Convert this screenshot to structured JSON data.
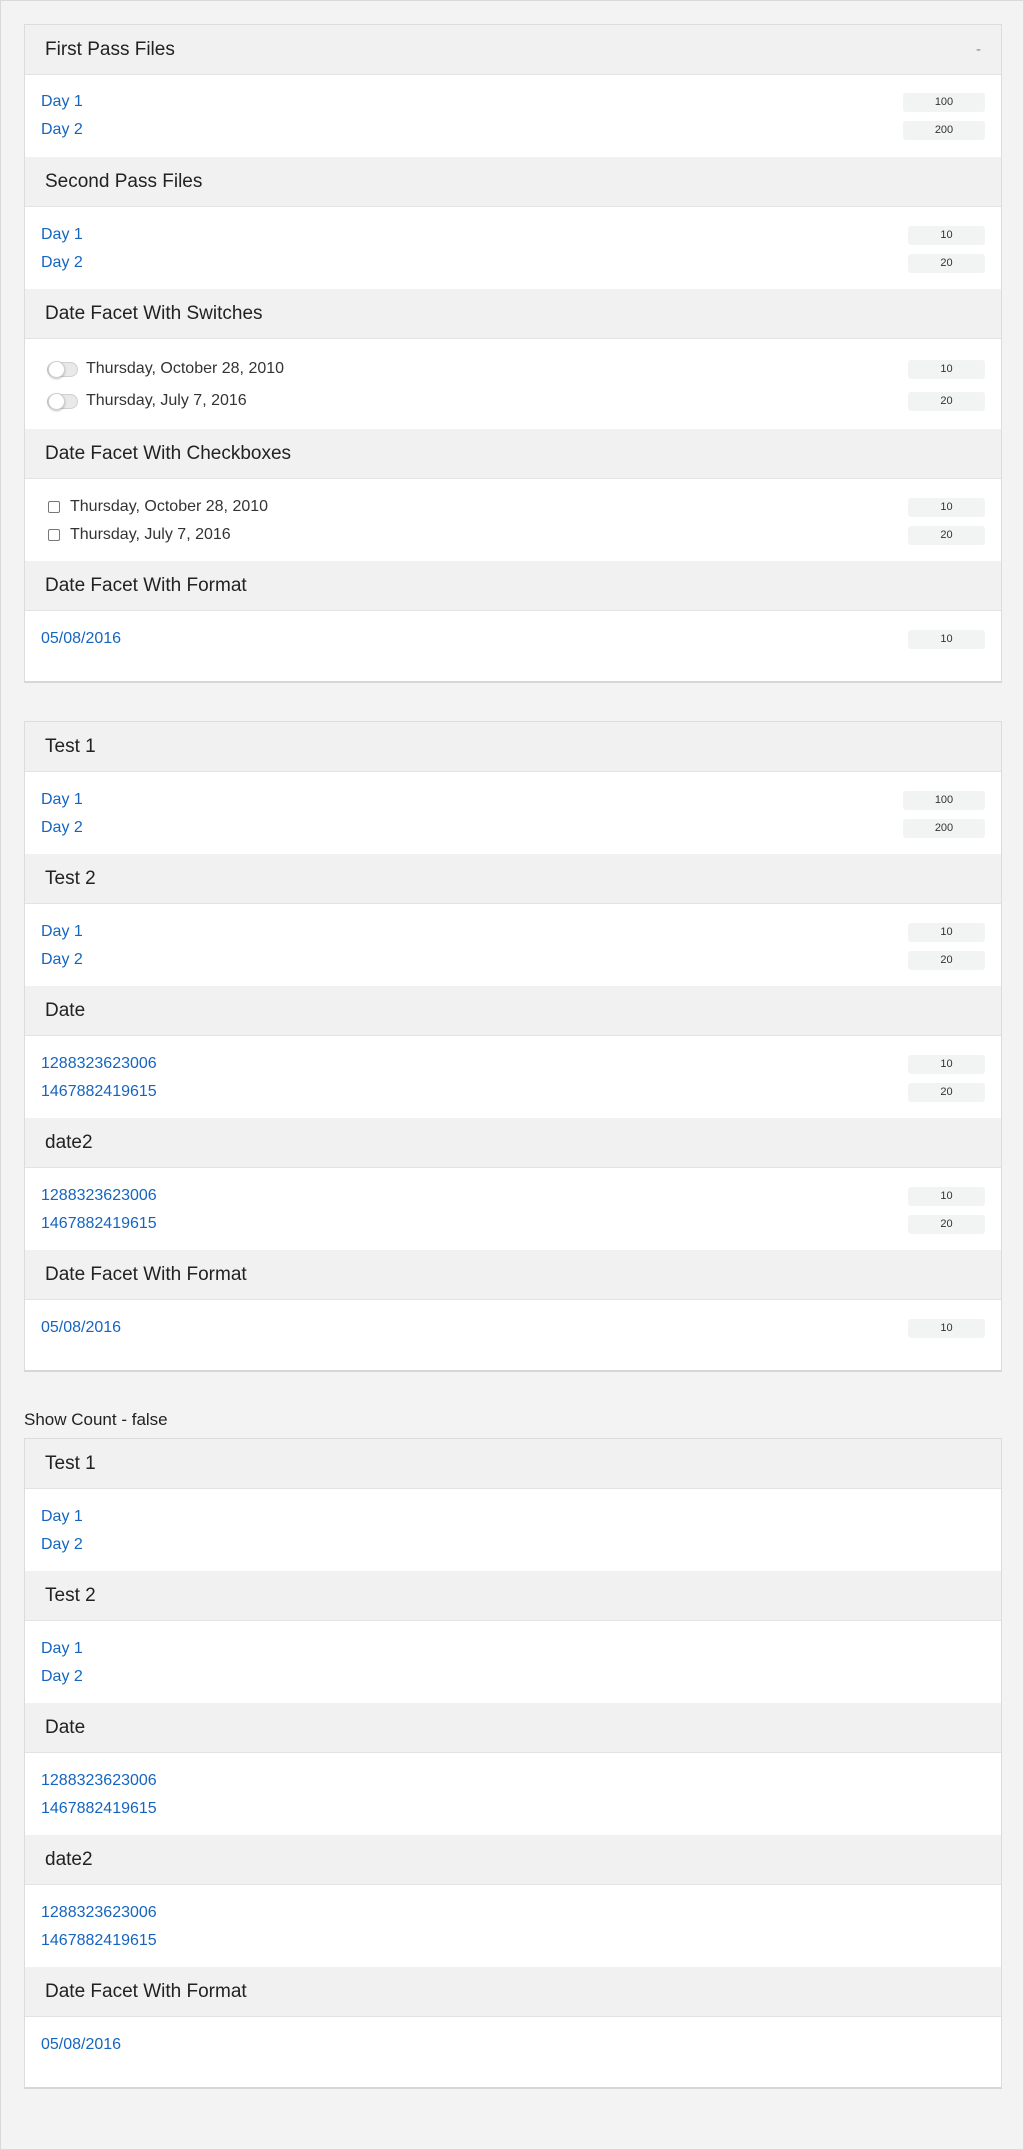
{
  "panel1": {
    "collapse_symbol": "-",
    "sections": [
      {
        "title": "First Pass Files",
        "items": [
          {
            "label": "Day 1",
            "count": "100"
          },
          {
            "label": "Day 2",
            "count": "200"
          }
        ]
      },
      {
        "title": "Second Pass Files",
        "items": [
          {
            "label": "Day 1",
            "count": "10"
          },
          {
            "label": "Day 2",
            "count": "20"
          }
        ]
      },
      {
        "title": "Date Facet With Switches",
        "items": [
          {
            "label": "Thursday, October 28, 2010",
            "count": "10"
          },
          {
            "label": "Thursday, July 7, 2016",
            "count": "20"
          }
        ]
      },
      {
        "title": "Date Facet With Checkboxes",
        "items": [
          {
            "label": "Thursday, October 28, 2010",
            "count": "10"
          },
          {
            "label": "Thursday, July 7, 2016",
            "count": "20"
          }
        ]
      },
      {
        "title": "Date Facet With Format",
        "items": [
          {
            "label": "05/08/2016",
            "count": "10"
          }
        ]
      }
    ]
  },
  "panel2": {
    "sections": [
      {
        "title": "Test 1",
        "items": [
          {
            "label": "Day 1",
            "count": "100"
          },
          {
            "label": "Day 2",
            "count": "200"
          }
        ]
      },
      {
        "title": "Test 2",
        "items": [
          {
            "label": "Day 1",
            "count": "10"
          },
          {
            "label": "Day 2",
            "count": "20"
          }
        ]
      },
      {
        "title": "Date",
        "items": [
          {
            "label": "1288323623006",
            "count": "10"
          },
          {
            "label": "1467882419615",
            "count": "20"
          }
        ]
      },
      {
        "title": "date2",
        "items": [
          {
            "label": "1288323623006",
            "count": "10"
          },
          {
            "label": "1467882419615",
            "count": "20"
          }
        ]
      },
      {
        "title": "Date Facet With Format",
        "items": [
          {
            "label": "05/08/2016",
            "count": "10"
          }
        ]
      }
    ]
  },
  "show_count_caption": "Show Count - false",
  "panel3": {
    "sections": [
      {
        "title": "Test 1",
        "items": [
          {
            "label": "Day 1"
          },
          {
            "label": "Day 2"
          }
        ]
      },
      {
        "title": "Test 2",
        "items": [
          {
            "label": "Day 1"
          },
          {
            "label": "Day 2"
          }
        ]
      },
      {
        "title": "Date",
        "items": [
          {
            "label": "1288323623006"
          },
          {
            "label": "1467882419615"
          }
        ]
      },
      {
        "title": "date2",
        "items": [
          {
            "label": "1288323623006"
          },
          {
            "label": "1467882419615"
          }
        ]
      },
      {
        "title": "Date Facet With Format",
        "items": [
          {
            "label": "05/08/2016"
          }
        ]
      }
    ]
  },
  "colors": {
    "link": "#1565c0",
    "header_bg": "#f1f1f1",
    "page_bg": "#f3f3f3",
    "count_bg": "#f2f3f3"
  }
}
